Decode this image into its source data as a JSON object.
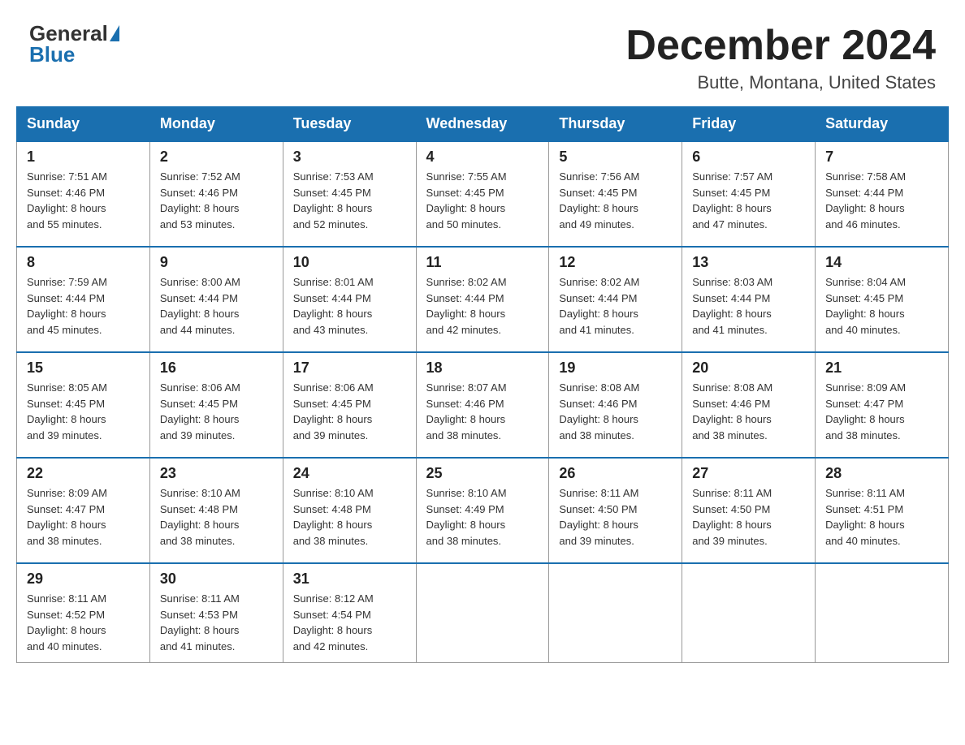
{
  "header": {
    "logo_general": "General",
    "logo_blue": "Blue",
    "month_title": "December 2024",
    "location": "Butte, Montana, United States"
  },
  "days": [
    "Sunday",
    "Monday",
    "Tuesday",
    "Wednesday",
    "Thursday",
    "Friday",
    "Saturday"
  ],
  "weeks": [
    [
      {
        "date": "1",
        "sunrise": "7:51 AM",
        "sunset": "4:46 PM",
        "daylight": "8 hours and 55 minutes."
      },
      {
        "date": "2",
        "sunrise": "7:52 AM",
        "sunset": "4:46 PM",
        "daylight": "8 hours and 53 minutes."
      },
      {
        "date": "3",
        "sunrise": "7:53 AM",
        "sunset": "4:45 PM",
        "daylight": "8 hours and 52 minutes."
      },
      {
        "date": "4",
        "sunrise": "7:55 AM",
        "sunset": "4:45 PM",
        "daylight": "8 hours and 50 minutes."
      },
      {
        "date": "5",
        "sunrise": "7:56 AM",
        "sunset": "4:45 PM",
        "daylight": "8 hours and 49 minutes."
      },
      {
        "date": "6",
        "sunrise": "7:57 AM",
        "sunset": "4:45 PM",
        "daylight": "8 hours and 47 minutes."
      },
      {
        "date": "7",
        "sunrise": "7:58 AM",
        "sunset": "4:44 PM",
        "daylight": "8 hours and 46 minutes."
      }
    ],
    [
      {
        "date": "8",
        "sunrise": "7:59 AM",
        "sunset": "4:44 PM",
        "daylight": "8 hours and 45 minutes."
      },
      {
        "date": "9",
        "sunrise": "8:00 AM",
        "sunset": "4:44 PM",
        "daylight": "8 hours and 44 minutes."
      },
      {
        "date": "10",
        "sunrise": "8:01 AM",
        "sunset": "4:44 PM",
        "daylight": "8 hours and 43 minutes."
      },
      {
        "date": "11",
        "sunrise": "8:02 AM",
        "sunset": "4:44 PM",
        "daylight": "8 hours and 42 minutes."
      },
      {
        "date": "12",
        "sunrise": "8:02 AM",
        "sunset": "4:44 PM",
        "daylight": "8 hours and 41 minutes."
      },
      {
        "date": "13",
        "sunrise": "8:03 AM",
        "sunset": "4:44 PM",
        "daylight": "8 hours and 41 minutes."
      },
      {
        "date": "14",
        "sunrise": "8:04 AM",
        "sunset": "4:45 PM",
        "daylight": "8 hours and 40 minutes."
      }
    ],
    [
      {
        "date": "15",
        "sunrise": "8:05 AM",
        "sunset": "4:45 PM",
        "daylight": "8 hours and 39 minutes."
      },
      {
        "date": "16",
        "sunrise": "8:06 AM",
        "sunset": "4:45 PM",
        "daylight": "8 hours and 39 minutes."
      },
      {
        "date": "17",
        "sunrise": "8:06 AM",
        "sunset": "4:45 PM",
        "daylight": "8 hours and 39 minutes."
      },
      {
        "date": "18",
        "sunrise": "8:07 AM",
        "sunset": "4:46 PM",
        "daylight": "8 hours and 38 minutes."
      },
      {
        "date": "19",
        "sunrise": "8:08 AM",
        "sunset": "4:46 PM",
        "daylight": "8 hours and 38 minutes."
      },
      {
        "date": "20",
        "sunrise": "8:08 AM",
        "sunset": "4:46 PM",
        "daylight": "8 hours and 38 minutes."
      },
      {
        "date": "21",
        "sunrise": "8:09 AM",
        "sunset": "4:47 PM",
        "daylight": "8 hours and 38 minutes."
      }
    ],
    [
      {
        "date": "22",
        "sunrise": "8:09 AM",
        "sunset": "4:47 PM",
        "daylight": "8 hours and 38 minutes."
      },
      {
        "date": "23",
        "sunrise": "8:10 AM",
        "sunset": "4:48 PM",
        "daylight": "8 hours and 38 minutes."
      },
      {
        "date": "24",
        "sunrise": "8:10 AM",
        "sunset": "4:48 PM",
        "daylight": "8 hours and 38 minutes."
      },
      {
        "date": "25",
        "sunrise": "8:10 AM",
        "sunset": "4:49 PM",
        "daylight": "8 hours and 38 minutes."
      },
      {
        "date": "26",
        "sunrise": "8:11 AM",
        "sunset": "4:50 PM",
        "daylight": "8 hours and 39 minutes."
      },
      {
        "date": "27",
        "sunrise": "8:11 AM",
        "sunset": "4:50 PM",
        "daylight": "8 hours and 39 minutes."
      },
      {
        "date": "28",
        "sunrise": "8:11 AM",
        "sunset": "4:51 PM",
        "daylight": "8 hours and 40 minutes."
      }
    ],
    [
      {
        "date": "29",
        "sunrise": "8:11 AM",
        "sunset": "4:52 PM",
        "daylight": "8 hours and 40 minutes."
      },
      {
        "date": "30",
        "sunrise": "8:11 AM",
        "sunset": "4:53 PM",
        "daylight": "8 hours and 41 minutes."
      },
      {
        "date": "31",
        "sunrise": "8:12 AM",
        "sunset": "4:54 PM",
        "daylight": "8 hours and 42 minutes."
      },
      null,
      null,
      null,
      null
    ]
  ],
  "labels": {
    "sunrise": "Sunrise:",
    "sunset": "Sunset:",
    "daylight": "Daylight:"
  }
}
